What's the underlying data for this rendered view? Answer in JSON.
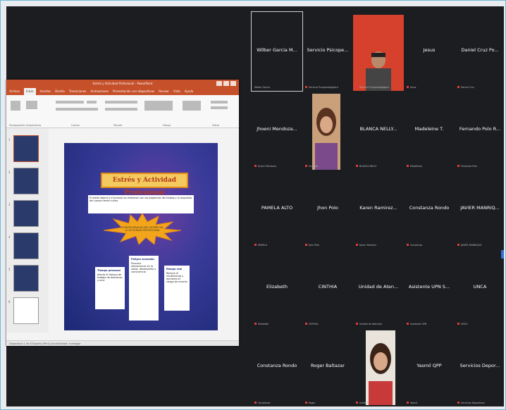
{
  "ppt": {
    "title": "Estrés y Actividad Profesional - PowerPoint",
    "tabs": [
      "Archivo",
      "Inicio",
      "Insertar",
      "Diseño",
      "Transiciones",
      "Animaciones",
      "Presentación con diapositivas",
      "Revisar",
      "Vista",
      "Ayuda"
    ],
    "ribbon_groups": [
      "Portapapeles",
      "Diapositivas",
      "Fuente",
      "Párrafo",
      "Dibujo",
      "Editar"
    ],
    "status": "Diapositiva 1 de 8  Español (Perú)  Accesibilidad: investigar"
  },
  "slide": {
    "title": "Estrés y Actividad Profesional",
    "intro": "El estrés laboral y el burnout se relacionan con las exigencias del trabajo y la respuesta del cuerpo frente a ellas.",
    "star_text": "CONSECUENCIAS DEL ESTRÉS EN LA ACTIVIDAD PROFESIONAL",
    "boxes": [
      {
        "heading": "Tiempo personal",
        "text": "Afecta el tiempo de trabajo de descanso y ocio"
      },
      {
        "heading": "Peligro acosador",
        "text": "Provoca alteraciones en la salud, desempeño y convivencia"
      },
      {
        "heading": "Riesgo real",
        "text": "Reduce el rendimiento y aumenta el riesgo de errores"
      }
    ]
  },
  "participants": [
    {
      "name": "Wilber Garcia M...",
      "foot": "Wilber Garcia",
      "mic": false
    },
    {
      "name": "Servicio Psicope...",
      "foot": "Servicio Psicopedagógico",
      "mic": true
    },
    {
      "name": "",
      "foot": "Servicio Psicopedagógico",
      "mic": true,
      "video": "man"
    },
    {
      "name": "Jesus",
      "foot": "Jesus",
      "mic": true
    },
    {
      "name": "Daniel Cruz Po...",
      "foot": "Daniel Cruz",
      "mic": true
    },
    {
      "name": "Jhoeni Mendoza...",
      "foot": "Jhoeni Mendoza",
      "mic": true
    },
    {
      "name": "",
      "foot": "Invitada",
      "mic": true,
      "video": "woman1"
    },
    {
      "name": "BLANCA NELLY...",
      "foot": "BLANCA NELLY",
      "mic": true
    },
    {
      "name": "Madeleine T.",
      "foot": "Madeleine",
      "mic": true
    },
    {
      "name": "Fernando Polo R...",
      "foot": "Fernando Polo",
      "mic": true
    },
    {
      "name": "PAMELA ALTO",
      "foot": "PAMELA",
      "mic": true
    },
    {
      "name": "Jhon Polo",
      "foot": "Jhon Polo",
      "mic": true
    },
    {
      "name": "Karen Ramirez...",
      "foot": "Karen Ramirez",
      "mic": true
    },
    {
      "name": "Constanza Rondo",
      "foot": "Constanza",
      "mic": true
    },
    {
      "name": "JAVIER MANRIQ...",
      "foot": "JAVIER MANRIQUE",
      "mic": true
    },
    {
      "name": "Elizabeth",
      "foot": "Elizabeth",
      "mic": true
    },
    {
      "name": "CINTHIA",
      "foot": "CINTHIA",
      "mic": true
    },
    {
      "name": "Unidad de Aten...",
      "foot": "Unidad de Atención",
      "mic": true
    },
    {
      "name": "Asistente UPN S...",
      "foot": "Asistente UPN",
      "mic": true
    },
    {
      "name": "UNCA",
      "foot": "UNCA",
      "mic": true
    },
    {
      "name": "Constanza Rondo",
      "foot": "Constanza",
      "mic": true
    },
    {
      "name": "Roger Baltazar",
      "foot": "Roger",
      "mic": true
    },
    {
      "name": "",
      "foot": "Invitada",
      "mic": true,
      "video": "woman2"
    },
    {
      "name": "Yasmil QPP",
      "foot": "Yasmil",
      "mic": true
    },
    {
      "name": "Servicios Depor...",
      "foot": "Servicios Deportivos",
      "mic": true
    }
  ]
}
